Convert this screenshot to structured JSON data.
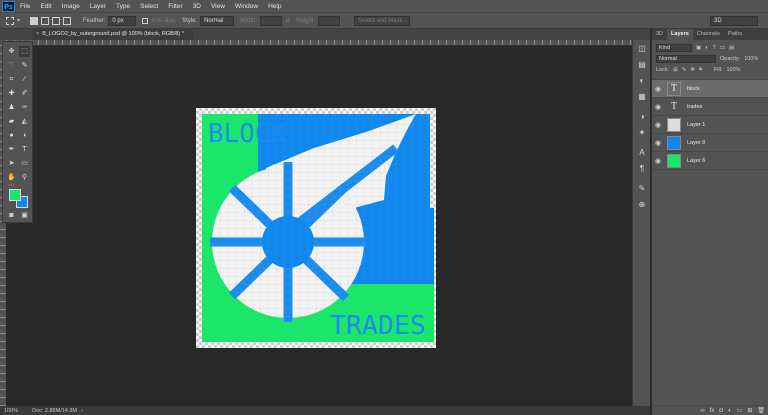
{
  "app": {
    "logo": "Ps"
  },
  "menu": [
    "File",
    "Edit",
    "Image",
    "Layer",
    "Type",
    "Select",
    "Filter",
    "3D",
    "View",
    "Window",
    "Help"
  ],
  "options_bar": {
    "feather_label": "Feather:",
    "feather_value": "0 px",
    "antialias_label": "Anti-alias",
    "style_label": "Style:",
    "style_value": "Normal",
    "width_label": "Width:",
    "height_label": "Height:",
    "select_mask_button": "Select and Mask...",
    "workspace": "3D"
  },
  "document_tab": {
    "title": "B_LOGO2_by_outerground.psd @ 100% (block, RGB/8) *",
    "close": "×"
  },
  "artwork": {
    "top_text": "BLOCK",
    "bottom_text": "TRADES",
    "colors": {
      "green": "#18e86a",
      "blue": "#0e87f0",
      "white": "#f2f2f2",
      "text_blue": "#1a8cf0"
    }
  },
  "toolbar": {
    "tools": [
      "move-tool",
      "marquee-tool",
      "lasso-tool",
      "quick-select-tool",
      "crop-tool",
      "eyedropper-tool",
      "healing-brush-tool",
      "brush-tool",
      "clone-stamp-tool",
      "history-brush-tool",
      "eraser-tool",
      "gradient-tool",
      "blur-tool",
      "dodge-tool",
      "pen-tool",
      "type-tool",
      "path-select-tool",
      "rectangle-tool",
      "hand-tool",
      "zoom-tool"
    ],
    "foreground_color": "#18e86a",
    "background_color": "#0e87f0"
  },
  "status": {
    "zoom": "100%",
    "doc": "Doc: 2.86M/14.3M"
  },
  "layers_panel": {
    "tabs": [
      "3D",
      "Layers",
      "Channels",
      "Paths"
    ],
    "active_tab": "Layers",
    "filter": "Kind",
    "blend_mode": "Normal",
    "opacity_label": "Opacity:",
    "opacity_value": "100%",
    "lock_label": "Lock:",
    "fill_label": "Fill:",
    "fill_value": "100%",
    "layers": [
      {
        "name": "block",
        "type": "text",
        "selected": true
      },
      {
        "name": "trades",
        "type": "text",
        "selected": false
      },
      {
        "name": "Layer 1",
        "type": "image",
        "selected": false
      },
      {
        "name": "Layer 8",
        "type": "blue-fill",
        "selected": false
      },
      {
        "name": "Layer 6",
        "type": "green-fill",
        "selected": false
      }
    ]
  }
}
